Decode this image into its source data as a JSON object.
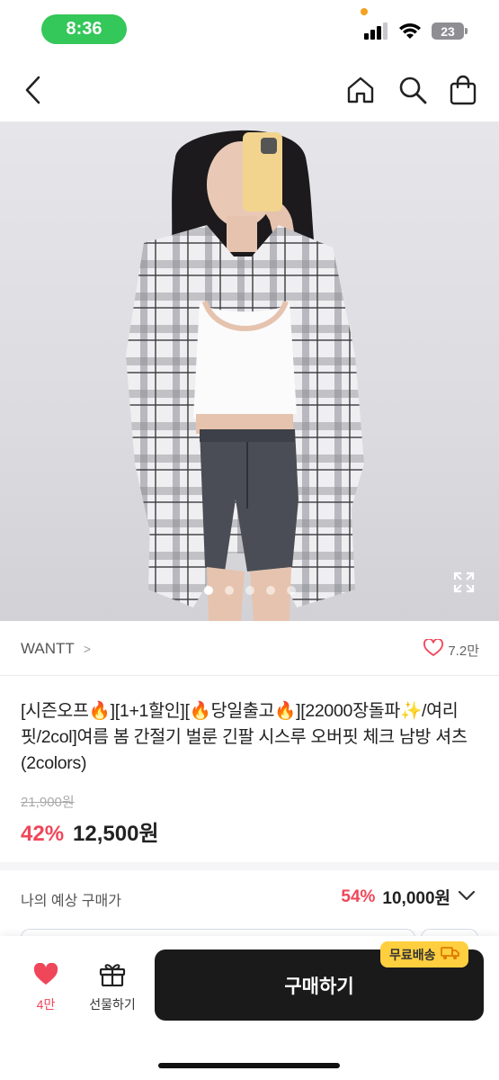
{
  "status_bar": {
    "time": "8:36",
    "battery": "23"
  },
  "nav": {
    "back_icon": "chevron-left-icon",
    "home_icon": "home-icon",
    "search_icon": "search-icon",
    "cart_icon": "shopping-bag-icon"
  },
  "hero": {
    "image_count": 5,
    "active_index": 0,
    "expand_icon": "expand-icon"
  },
  "brand": {
    "name": "WANTT",
    "chevron": ">",
    "likes": "7.2만"
  },
  "product": {
    "title": "[시즌오프🔥][1+1할인][🔥당일출고🔥][22000장돌파✨/여리핏/2col]여름 봄 간절기 벌룬 긴팔 시스루 오버핏 체크 남방 셔츠(2colors)",
    "original_price": "21,900원",
    "discount": "42%",
    "price": "12,500원"
  },
  "estimate": {
    "label": "나의 예상 구매가",
    "discount": "54%",
    "price": "10,000원"
  },
  "bottom_bar": {
    "wish_count": "4만",
    "gift_label": "선물하기",
    "buy_label": "구매하기",
    "shipping_badge": "무료배송"
  },
  "colors": {
    "accent": "#f0465a",
    "buy_button": "#1a1a1a",
    "badge": "#ffcf3f",
    "status_pill": "#34c759"
  }
}
